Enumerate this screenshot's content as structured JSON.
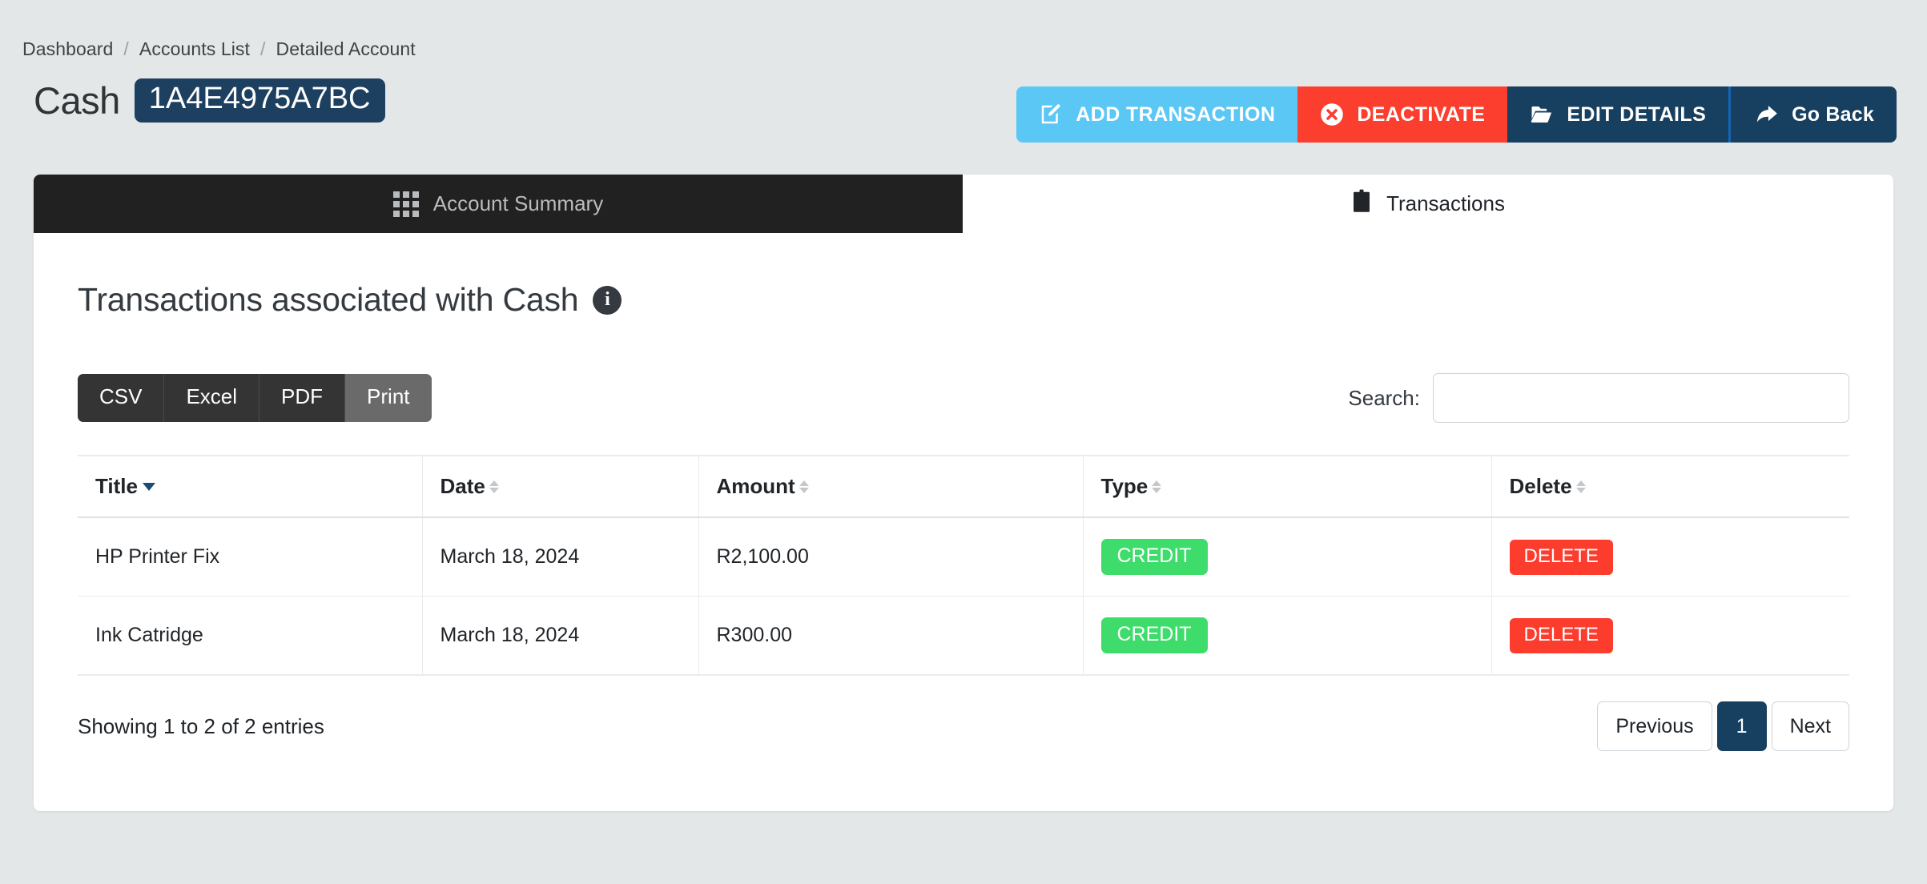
{
  "breadcrumb": {
    "items": [
      "Dashboard",
      "Accounts List",
      "Detailed Account"
    ],
    "separator": "/"
  },
  "header": {
    "account_name": "Cash",
    "account_code": "1A4E4975A7BC",
    "actions": [
      {
        "label": "ADD TRANSACTION",
        "icon": "edit-square-icon",
        "color": "#5bc7f5"
      },
      {
        "label": "DEACTIVATE",
        "icon": "x-circle-icon",
        "color": "#fb3e2e"
      },
      {
        "label": "EDIT DETAILS",
        "icon": "folder-open-icon",
        "color": "#173f5f"
      },
      {
        "label": "Go Back",
        "icon": "share-arrow-icon",
        "color": "#173f5f"
      }
    ]
  },
  "tabs": [
    {
      "label": "Account Summary",
      "icon": "grid-icon",
      "active": true
    },
    {
      "label": "Transactions",
      "icon": "clipboard-icon",
      "active": false
    }
  ],
  "main": {
    "section_title": "Transactions associated with Cash",
    "info_icon_char": "i"
  },
  "toolbar": {
    "export_buttons": [
      {
        "label": "CSV",
        "active": false
      },
      {
        "label": "Excel",
        "active": false
      },
      {
        "label": "PDF",
        "active": false
      },
      {
        "label": "Print",
        "active": true
      }
    ],
    "search_label": "Search:",
    "search_value": "",
    "search_placeholder": ""
  },
  "table": {
    "columns": [
      {
        "label": "Title",
        "sort": "desc"
      },
      {
        "label": "Date",
        "sort": "none"
      },
      {
        "label": "Amount",
        "sort": "none"
      },
      {
        "label": "Type",
        "sort": "none"
      },
      {
        "label": "Delete",
        "sort": "none"
      }
    ],
    "rows": [
      {
        "title": "HP Printer Fix",
        "date": "March 18, 2024",
        "amount": "R2,100.00",
        "type": "CREDIT",
        "delete_label": "DELETE"
      },
      {
        "title": "Ink Catridge",
        "date": "March 18, 2024",
        "amount": "R300.00",
        "type": "CREDIT",
        "delete_label": "DELETE"
      }
    ]
  },
  "footer": {
    "entries_info": "Showing 1 to 2 of 2 entries",
    "pagination": {
      "previous_label": "Previous",
      "next_label": "Next",
      "pages": [
        "1"
      ],
      "current_page": "1"
    }
  },
  "colors": {
    "page_background": "#e3e7e8",
    "navy": "#173f5f",
    "sky": "#5bc7f5",
    "red": "#fb3e2e",
    "green": "#3ddc6b",
    "delete_red": "#fc3c2d",
    "dark_tab": "#212121"
  }
}
